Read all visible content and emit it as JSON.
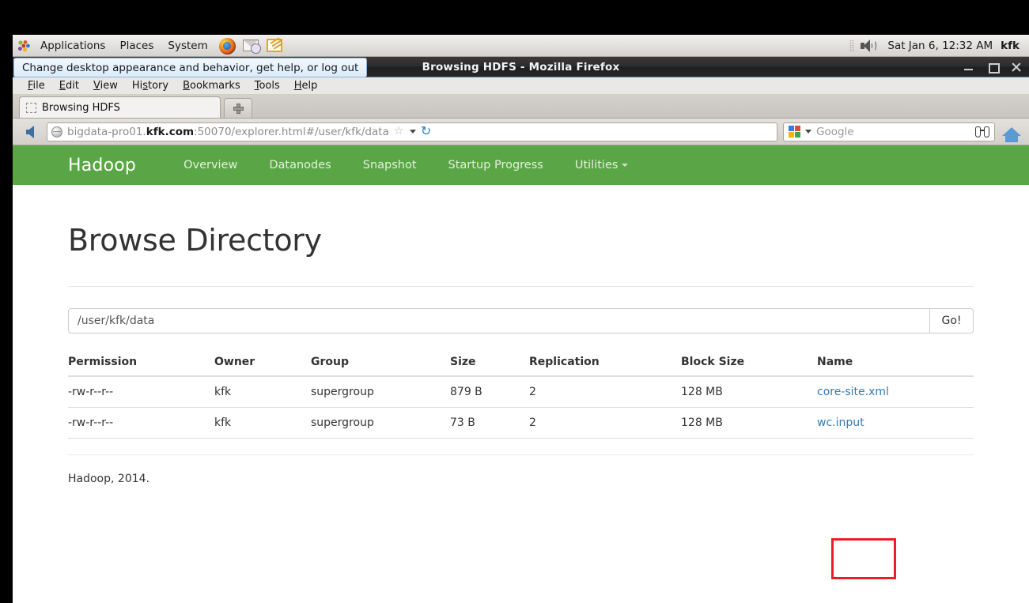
{
  "desktop": {
    "panel": {
      "menus": [
        "Applications",
        "Places",
        "System"
      ],
      "launchers": [
        "firefox-icon",
        "mail-icon",
        "text-editor-icon"
      ],
      "volume_icon": "volume-icon",
      "clock": "Sat Jan  6, 12:32 AM",
      "user": "kfk"
    },
    "tooltip": "Change desktop appearance and behavior, get help, or log out"
  },
  "browser": {
    "title": "Browsing HDFS - Mozilla Firefox",
    "window_buttons": [
      "minimize-button",
      "maximize-button",
      "close-button"
    ],
    "menus": [
      {
        "pre": "",
        "key": "F",
        "post": "ile"
      },
      {
        "pre": "",
        "key": "E",
        "post": "dit"
      },
      {
        "pre": "",
        "key": "V",
        "post": "iew"
      },
      {
        "pre": "Hi",
        "key": "s",
        "post": "tory"
      },
      {
        "pre": "",
        "key": "B",
        "post": "ookmarks"
      },
      {
        "pre": "",
        "key": "T",
        "post": "ools"
      },
      {
        "pre": "",
        "key": "H",
        "post": "elp"
      }
    ],
    "tab": {
      "label": "Browsing HDFS",
      "new_tab_label": "+"
    },
    "url": {
      "prefix": "bigdata-pro01.",
      "domain": "kfk.com",
      "suffix": ":50070/explorer.html#/user/kfk/data"
    },
    "search": {
      "engine": "Google",
      "placeholder": "Google"
    }
  },
  "hadoop": {
    "brand": "Hadoop",
    "nav": [
      {
        "label": "Overview",
        "caret": false
      },
      {
        "label": "Datanodes",
        "caret": false
      },
      {
        "label": "Snapshot",
        "caret": false
      },
      {
        "label": "Startup Progress",
        "caret": false
      },
      {
        "label": "Utilities",
        "caret": true
      }
    ],
    "page_title": "Browse Directory",
    "path_value": "/user/kfk/data",
    "go_label": "Go!",
    "table": {
      "headers": [
        "Permission",
        "Owner",
        "Group",
        "Size",
        "Replication",
        "Block Size",
        "Name"
      ],
      "rows": [
        {
          "permission": "-rw-r--r--",
          "owner": "kfk",
          "group": "supergroup",
          "size": "879 B",
          "replication": "2",
          "block_size": "128 MB",
          "name": "core-site.xml"
        },
        {
          "permission": "-rw-r--r--",
          "owner": "kfk",
          "group": "supergroup",
          "size": "73 B",
          "replication": "2",
          "block_size": "128 MB",
          "name": "wc.input"
        }
      ]
    },
    "footer": "Hadoop, 2014."
  },
  "annotation": {
    "target": "wc.input",
    "color": "#ee1c25"
  },
  "colors": {
    "hadoop_green": "#5aa545",
    "link_blue": "#337ab7",
    "annotation_red": "#ee1c25"
  }
}
